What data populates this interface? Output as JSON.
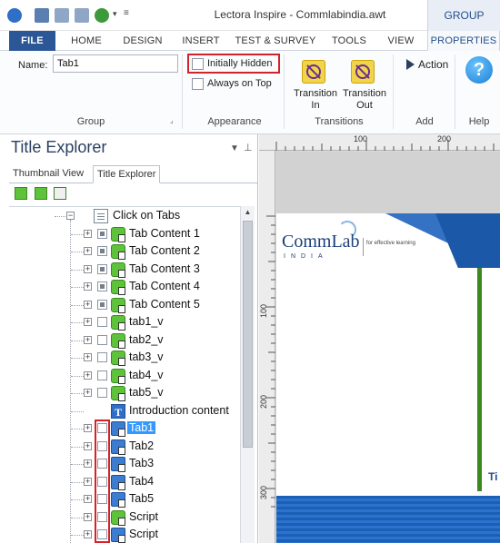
{
  "window": {
    "title": "Lectora Inspire - Commlabindia.awt",
    "contextual_group": "GROUP"
  },
  "menu": {
    "tabs": [
      "FILE",
      "HOME",
      "DESIGN",
      "INSERT",
      "TEST & SURVEY",
      "TOOLS",
      "VIEW",
      "PROPERTIES"
    ]
  },
  "ribbon": {
    "name_label": "Name:",
    "name_value": "Tab1",
    "initially_hidden": "Initially Hidden",
    "always_on_top": "Always on Top",
    "transition_in": "Transition In",
    "transition_out": "Transition Out",
    "action": "Action",
    "groups": {
      "group": "Group",
      "appearance": "Appearance",
      "transitions": "Transitions",
      "add": "Add",
      "help": "Help"
    }
  },
  "panel": {
    "title": "Title Explorer",
    "tabs": [
      "Thumbnail View",
      "Title Explorer"
    ]
  },
  "tree": [
    {
      "label": "Click on Tabs",
      "icon": "page",
      "check": "none",
      "expander": "minus"
    },
    {
      "label": "Tab Content 1",
      "icon": "group",
      "check": "filled",
      "expander": "plus"
    },
    {
      "label": "Tab Content 2",
      "icon": "group",
      "check": "filled",
      "expander": "plus"
    },
    {
      "label": "Tab Content 3",
      "icon": "group",
      "check": "filled",
      "expander": "plus"
    },
    {
      "label": "Tab Content 4",
      "icon": "group",
      "check": "filled",
      "expander": "plus"
    },
    {
      "label": "Tab Content 5",
      "icon": "group",
      "check": "filled",
      "expander": "plus"
    },
    {
      "label": "tab1_v",
      "icon": "group",
      "check": "empty",
      "expander": "plus"
    },
    {
      "label": "tab2_v",
      "icon": "group",
      "check": "empty",
      "expander": "plus"
    },
    {
      "label": "tab3_v",
      "icon": "group",
      "check": "empty",
      "expander": "plus"
    },
    {
      "label": "tab4_v",
      "icon": "group",
      "check": "empty",
      "expander": "plus"
    },
    {
      "label": "tab5_v",
      "icon": "group",
      "check": "empty",
      "expander": "plus"
    },
    {
      "label": "Introduction content",
      "icon": "text",
      "check": "none",
      "expander": "none"
    },
    {
      "label": "Tab1",
      "icon": "button",
      "check": "empty",
      "expander": "plus",
      "selected": true
    },
    {
      "label": "Tab2",
      "icon": "button",
      "check": "empty",
      "expander": "plus"
    },
    {
      "label": "Tab3",
      "icon": "button",
      "check": "empty",
      "expander": "plus"
    },
    {
      "label": "Tab4",
      "icon": "button",
      "check": "empty",
      "expander": "plus"
    },
    {
      "label": "Tab5",
      "icon": "button",
      "check": "empty",
      "expander": "plus"
    },
    {
      "label": "Script",
      "icon": "group",
      "check": "empty",
      "expander": "plus"
    },
    {
      "label": "Script",
      "icon": "button",
      "check": "empty",
      "expander": "plus"
    }
  ],
  "ruler": {
    "h_labels": [
      "100",
      "200"
    ],
    "v_labels": [
      "100",
      "200",
      "300"
    ]
  },
  "slide": {
    "logo_main": "CommLab",
    "logo_sub": "INDIA",
    "logo_tag": "for effective learning",
    "partial_text": "Ti"
  },
  "colors": {
    "file_tab": "#2b5797",
    "selection": "#3399ff",
    "highlight_box": "#d2232a",
    "slide_blue": "#1b58a8",
    "slide_green": "#3a8a1e"
  }
}
